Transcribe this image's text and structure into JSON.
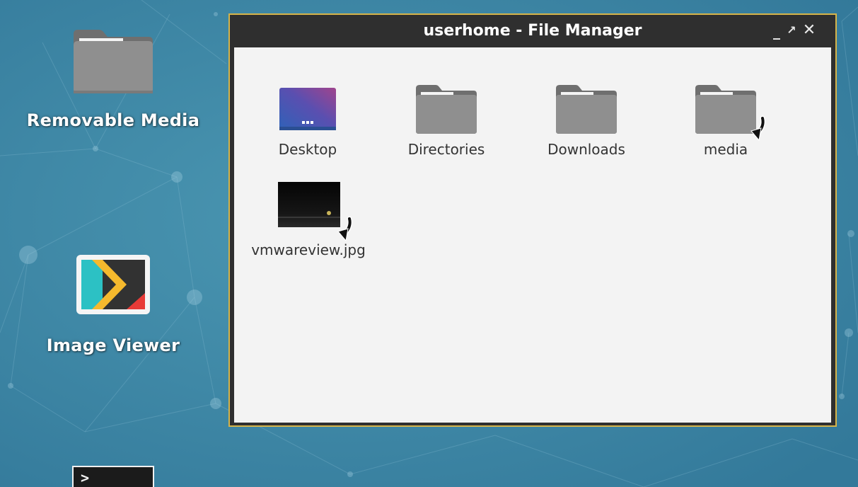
{
  "desktop": {
    "icons": [
      {
        "label": "Removable Media",
        "icon": "folder-icon"
      },
      {
        "label": "Image Viewer",
        "icon": "image-viewer-icon"
      },
      {
        "label": "",
        "icon": "terminal-icon",
        "glyph": ">"
      }
    ]
  },
  "window": {
    "title": "userhome - File Manager",
    "buttons": {
      "minimize": "_",
      "maximize": "↗",
      "close": "✕"
    },
    "items": [
      {
        "label": "Desktop",
        "icon": "desktop-folder-icon",
        "symlink": false
      },
      {
        "label": "Directories",
        "icon": "folder-icon",
        "symlink": false
      },
      {
        "label": "Downloads",
        "icon": "folder-icon",
        "symlink": false
      },
      {
        "label": "media",
        "icon": "folder-icon",
        "symlink": true
      },
      {
        "label": "vmwareview.jpg",
        "icon": "image-file-icon",
        "symlink": true
      }
    ]
  },
  "colors": {
    "desktop_background": "#3f8aa6",
    "titlebar": "#2f2f2f",
    "window_border": "#d6b44a",
    "content_background": "#f3f3f3",
    "folder_gray": "#8f8f8f"
  }
}
